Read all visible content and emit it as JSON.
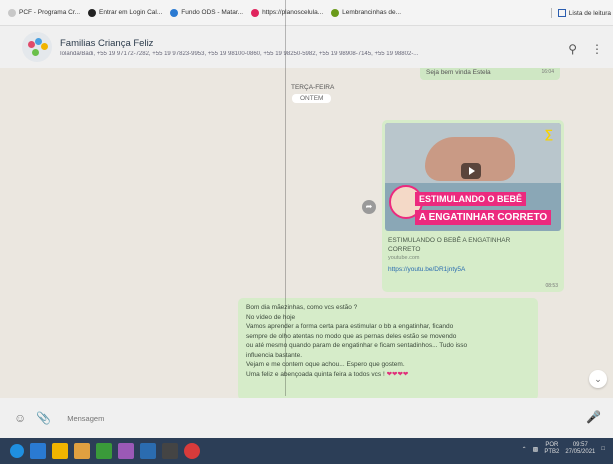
{
  "bookmarks": [
    {
      "label": "PCF - Programa Cr...",
      "icon": "pcf-bookmark-icon",
      "color": "#c8c8c8"
    },
    {
      "label": "Entrar em Login Cal...",
      "icon": "github-icon",
      "color": "#222222"
    },
    {
      "label": "Fundo ODS - Matar...",
      "icon": "globe-icon",
      "color": "#2a7ad2"
    },
    {
      "label": "https://planoscelula...",
      "icon": "pocket-icon",
      "color": "#e0245e"
    },
    {
      "label": "Lembrancinhas de...",
      "icon": "leaf-icon",
      "color": "#6a9a1a"
    }
  ],
  "bookmarks_right": "Lista de leitura",
  "header": {
    "title": "Familias Criança Feliz",
    "subtitle": "Iolanda/Badi, +55 19 97172-7282, +55 19 97823-9953, +55 19 98100-0860, +55 19 98250-5982, +55 19 98908-7145, +55 19 98802-..."
  },
  "chat": {
    "top_bubble": {
      "text": "Seja bem vinda Estela",
      "time": "16:04"
    },
    "day_label": "TERÇA-FEIRA",
    "yesterday": "ONTEM",
    "media": {
      "banner_line1": "ESTIMULANDO O BEBÊ",
      "banner_line2": "A ENGATINHAR CORRETO",
      "preview_title_line1": "ESTIMULANDO O BEBÊ A ENGATINHAR",
      "preview_title_line2": "CORRETO",
      "domain": "youtube.com",
      "link": "https://youtu.be/DR1jnty5A",
      "time": "08:53"
    },
    "message_lines": [
      "Bom dia mãezinhas, como vcs estão ?",
      "No vídeo de hoje",
      "Vamos aprender a forma certa para estimular o bb a engatinhar, ficando",
      "sempre de olho atentas no modo que as pernas deles estão se movendo",
      "ou até mesmo quando param de engatinhar e ficam sentadinhos... Tudo isso",
      "influencia bastante.",
      "Vejam e me contem oque achou... Espero que gostem.",
      "Uma feliz e abençoada quinta feira a todos vcs !"
    ],
    "message_hearts": "❤❤❤❤"
  },
  "composer": {
    "placeholder": "Mensagem"
  },
  "taskbar": {
    "lang": "POR",
    "lang2": "PTB2",
    "time": "09:57",
    "date": "27/05/2021",
    "apps": [
      "#1f8fe0",
      "#2a7ad2",
      "#f0b400",
      "#f0b400",
      "#3a9a3a",
      "#9b59b6",
      "#2b6cb0",
      "#444",
      "#d83b3b"
    ]
  }
}
